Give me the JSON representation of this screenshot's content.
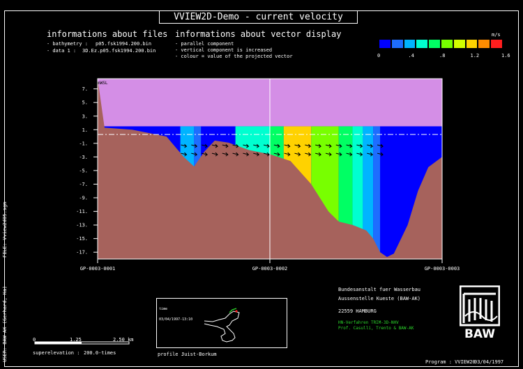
{
  "title": "VVIEW2D-Demo  -  current velocity",
  "files": {
    "heading": "informations about files",
    "lines": [
      {
        "label": "- bathymetry :",
        "value": "p05.fsk1994.200.bin"
      },
      {
        "label": "- data 1 :",
        "value": "3D.Ez.p05.fsk1994.200.bin"
      }
    ]
  },
  "vectors": {
    "heading": "informations about vector display",
    "lines": [
      "- parallel component",
      "- vertical component is increased",
      "- colour = value of the projected vector"
    ]
  },
  "velocity_legend": {
    "unit": "m/s",
    "colors": [
      "#0000ff",
      "#1e6dff",
      "#00b4ff",
      "#00ffd0",
      "#00ff64",
      "#78ff00",
      "#d2ff00",
      "#ffd200",
      "#ff8c00",
      "#ff1e1e"
    ],
    "ticks": [
      "0",
      ".4",
      ".8",
      "1.2",
      "1.6"
    ]
  },
  "chart_data": {
    "type": "area",
    "title": "",
    "ylabel": "mWSL",
    "yticks": [
      "7.",
      "5.",
      "3.",
      "1.",
      "-1.",
      "-3.",
      "-5.",
      "-7.",
      "-9.",
      "-11.",
      "-13.",
      "-15.",
      "-17."
    ],
    "ylim": [
      -18,
      8.5
    ],
    "water_level": 0.3,
    "x_labels": [
      "GP-0003-0001",
      "GP-0003-0002",
      "GP-0003-0003"
    ],
    "bed_profile": {
      "x": [
        0,
        0.02,
        0.1,
        0.2,
        0.25,
        0.28,
        0.31,
        0.34,
        0.38,
        0.44,
        0.5,
        0.56,
        0.62,
        0.67,
        0.7,
        0.74,
        0.78,
        0.8,
        0.82,
        0.84,
        0.86,
        0.9,
        0.93,
        0.96,
        1.0
      ],
      "depth": [
        8.5,
        1.3,
        1.0,
        0.0,
        -3.0,
        -4.4,
        -2.2,
        -0.6,
        -0.9,
        -2.0,
        -2.6,
        -3.6,
        -7.0,
        -11.0,
        -12.5,
        -13.0,
        -13.8,
        -15.0,
        -17.0,
        -17.7,
        -17.2,
        -13.0,
        -8.0,
        -4.5,
        -3.0
      ]
    },
    "colors": {
      "bed": "#a6625c",
      "air": "#d48ee6"
    }
  },
  "scale_bar": {
    "ticks": [
      "0",
      "1.25",
      "2.50 km"
    ],
    "superelevation_label": "superelevation :",
    "superelevation_value": "200.0-times"
  },
  "profile": {
    "label": "profile :",
    "value": "Juist-Borkum"
  },
  "map": {
    "time_label": "time",
    "time_value": "03/04/1997-13:10"
  },
  "institution": {
    "lines": [
      "Bundesanstalt fuer Wasserbau",
      "Aussenstelle Kueste (BAW-AK)",
      "22559 HAMBURG"
    ],
    "green_lines": [
      "HN-Verfahren TRIM-3D-NHV",
      "Prof. Casulli, Trento & BAW-AK"
    ],
    "logo_text": "BAW"
  },
  "side_labels": {
    "file": "FILE: Vview2d05.sgm",
    "user": "USER: BAW-AK (Gerhard, Ka)"
  },
  "footer": {
    "program": "Program : VVIEW20",
    "date": "03/04/1997"
  }
}
